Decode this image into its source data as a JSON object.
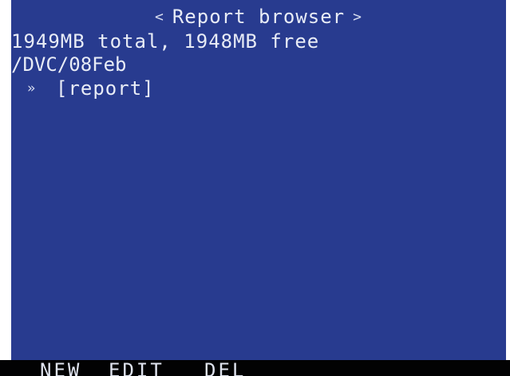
{
  "header": {
    "title": "Report browser",
    "prev_arrow": "<",
    "next_arrow": ">"
  },
  "storage": {
    "summary": "1949MB total, 1948MB free"
  },
  "location": {
    "path": "/DVC/08Feb"
  },
  "list": {
    "items": [
      {
        "cursor": "»",
        "label": "[report]",
        "selected": true
      }
    ]
  },
  "softkeys": {
    "new_label": "NEW",
    "edit_label": "EDIT",
    "del_label": "DEL"
  },
  "colors": {
    "screen_background": "#283b8f",
    "text": "#e8ecf6",
    "softkey_bar": "#020203"
  }
}
